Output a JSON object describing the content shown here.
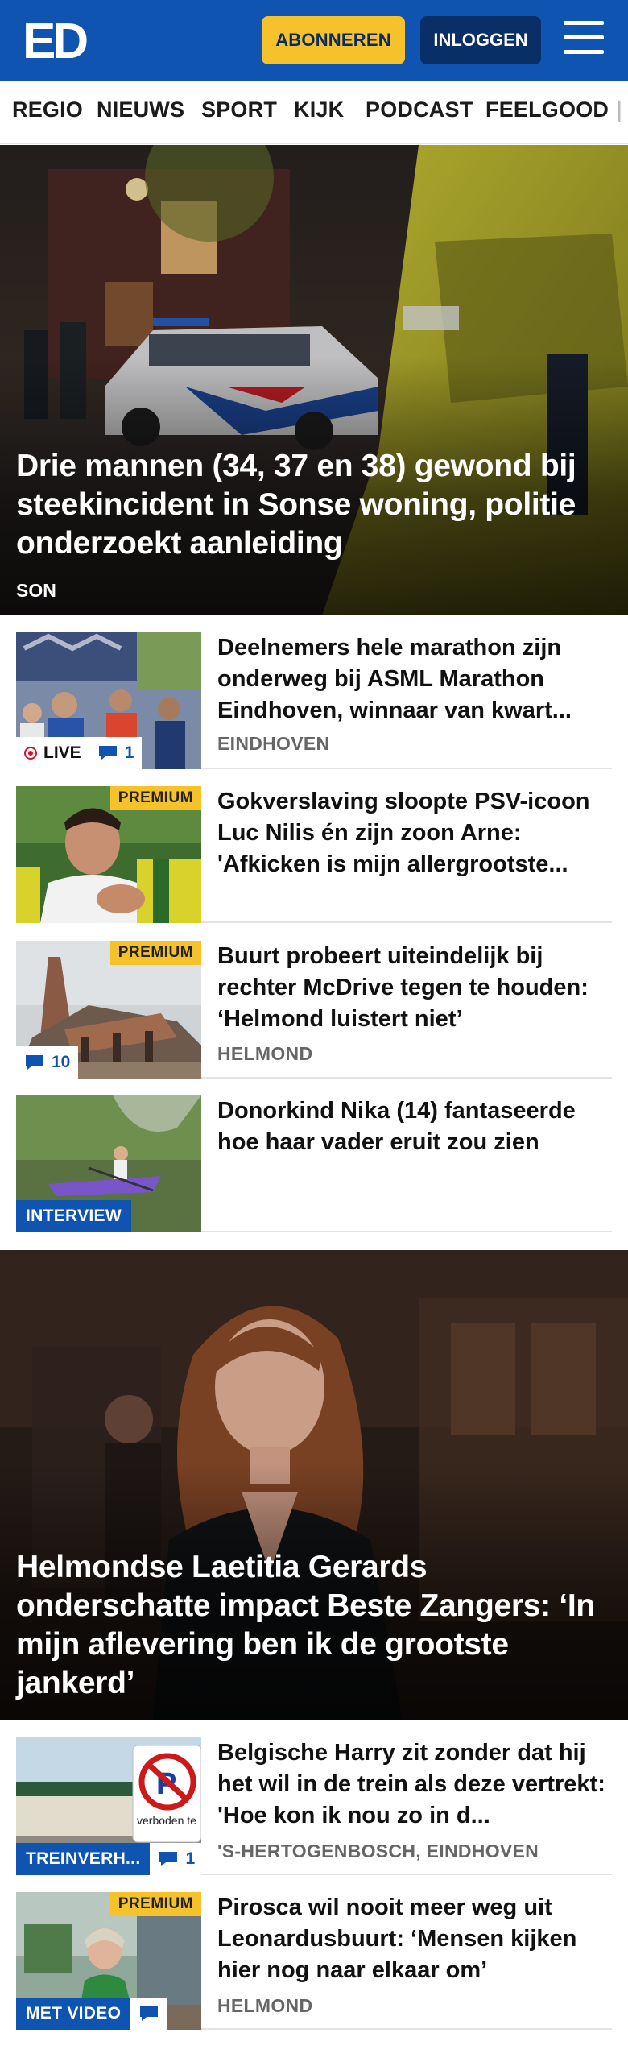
{
  "header": {
    "logo_text": "ED",
    "subscribe_label": "ABONNEREN",
    "login_label": "INLOGGEN",
    "menu_icon": "hamburger-menu-icon",
    "colors": {
      "brand_blue": "#0f54b0",
      "accent_yellow": "#f6c22b",
      "dark_blue": "#0a2f66"
    }
  },
  "nav": {
    "items": [
      "REGIO",
      "NIEUWS",
      "SPORT",
      "KIJK",
      "PODCAST",
      "FEELGOOD"
    ]
  },
  "hero1": {
    "title": "Drie mannen (34, 37 en 38) gewond bij steekincident in Sonse woning, politie onderzoekt aanleiding",
    "location": "SON"
  },
  "articles1": [
    {
      "title": "Deelnemers hele marathon zijn onderweg bij ASML Marathon Eindhoven, winnaar van kwart...",
      "meta": "EINDHOVEN",
      "live_label": "LIVE",
      "comments": "1"
    },
    {
      "title": "Gokverslaving sloopte PSV-icoon Luc Nilis én zijn zoon Arne: 'Afkicken is mijn allergrootste...",
      "premium_label": "PREMIUM"
    },
    {
      "title": "Buurt probeert uiteindelijk bij rechter McDrive tegen te houden: ‘Helmond luistert niet’",
      "meta": "HELMOND",
      "premium_label": "PREMIUM",
      "comments": "10"
    },
    {
      "title": "Donorkind Nika (14) fantaseerde hoe haar vader eruit zou zien",
      "tag_label": "INTERVIEW"
    }
  ],
  "hero2": {
    "title": "Helmondse Laetitia Gerards onderschatte impact Beste Zangers: ‘In mijn aflevering ben ik de grootste jankerd’"
  },
  "articles2": [
    {
      "title": "Belgische Harry zit zonder dat hij het wil in de trein als deze vertrekt: 'Hoe kon ik nou zo in d...",
      "meta": "'S-HERTOGENBOSCH, EINDHOVEN",
      "tag_label": "TREINVERH...",
      "comments": "1",
      "sign_text": "verboden te"
    },
    {
      "title": "Pirosca wil nooit meer weg uit Leonardusbuurt: ‘Mensen kijken hier nog naar elkaar om’",
      "meta": "HELMOND",
      "premium_label": "PREMIUM",
      "tag_label": "MET VIDEO"
    }
  ]
}
